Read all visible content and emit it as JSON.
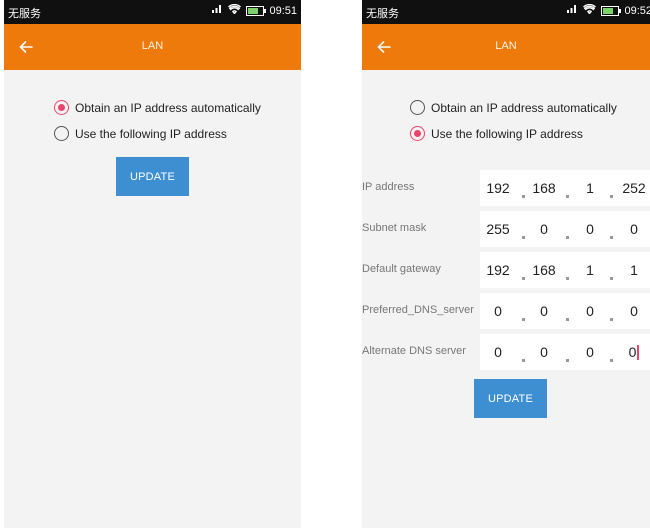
{
  "status_bar": {
    "carrier": "无服务",
    "time_left": "09:51",
    "time_right": "09:52"
  },
  "app_bar": {
    "title": "LAN"
  },
  "options": {
    "auto": "Obtain an IP address automatically",
    "manual": "Use the following IP address"
  },
  "update_label": "UPDATE",
  "fields": [
    {
      "label": "IP address",
      "octets": [
        "192",
        "168",
        "1",
        "252"
      ]
    },
    {
      "label": "Subnet mask",
      "octets": [
        "255",
        "0",
        "0",
        "0"
      ]
    },
    {
      "label": "Default gateway",
      "octets": [
        "192",
        "168",
        "1",
        "1"
      ]
    },
    {
      "label": "Preferred_DNS_server",
      "octets": [
        "0",
        "0",
        "0",
        "0"
      ]
    },
    {
      "label": "Alternate DNS server",
      "octets": [
        "0",
        "0",
        "0",
        "0"
      ]
    }
  ],
  "colors": {
    "app_bar": "#ef7a0c",
    "accent": "#e8466c",
    "button": "#3e8fd2"
  },
  "icons": {
    "back": "arrow-left-icon",
    "signal": "signal-icon",
    "wifi": "wifi-icon",
    "battery": "battery-icon"
  }
}
